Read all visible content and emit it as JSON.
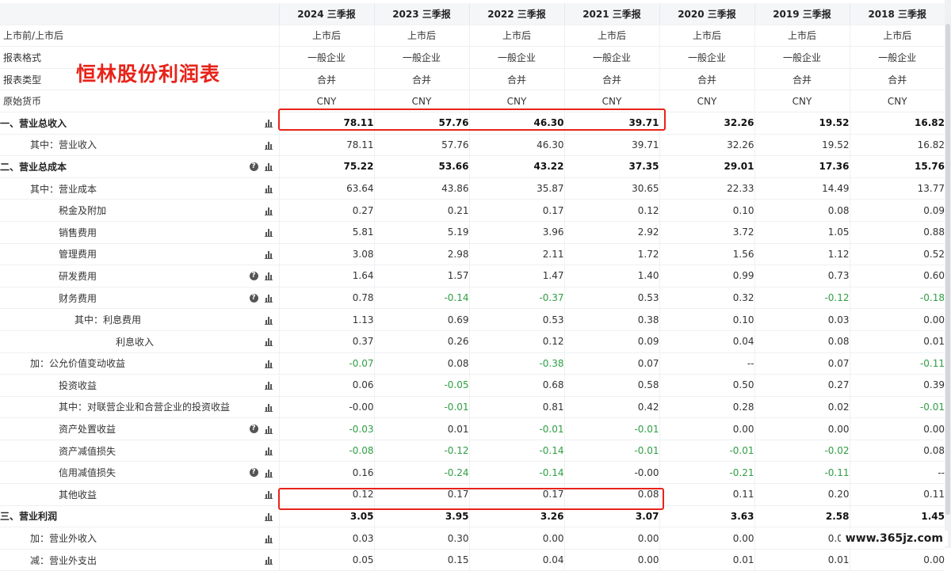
{
  "overlay_title": "恒林股份利润表",
  "watermark": "www.365jz.com",
  "columns": [
    "2024 三季报",
    "2023 三季报",
    "2022 三季报",
    "2021 三季报",
    "2020 三季报",
    "2019 三季报",
    "2018 三季报"
  ],
  "meta_rows": [
    {
      "label": "上市前/上市后",
      "values": [
        "上市后",
        "上市后",
        "上市后",
        "上市后",
        "上市后",
        "上市后",
        "上市后"
      ]
    },
    {
      "label": "报表格式",
      "values": [
        "一般企业",
        "一般企业",
        "一般企业",
        "一般企业",
        "一般企业",
        "一般企业",
        "一般企业"
      ]
    },
    {
      "label": "报表类型",
      "values": [
        "合并",
        "合并",
        "合并",
        "合并",
        "合并",
        "合并",
        "合并"
      ]
    },
    {
      "label": "原始货币",
      "values": [
        "CNY",
        "CNY",
        "CNY",
        "CNY",
        "CNY",
        "CNY",
        "CNY"
      ]
    }
  ],
  "rows": [
    {
      "label": "一、营业总收入",
      "indent": 0,
      "bold": true,
      "help": false,
      "values": [
        "78.11",
        "57.76",
        "46.30",
        "39.71",
        "32.26",
        "19.52",
        "16.82"
      ]
    },
    {
      "label": "其中：营业收入",
      "indent": 1,
      "bold": false,
      "help": false,
      "values": [
        "78.11",
        "57.76",
        "46.30",
        "39.71",
        "32.26",
        "19.52",
        "16.82"
      ]
    },
    {
      "label": "二、营业总成本",
      "indent": 0,
      "bold": true,
      "help": true,
      "values": [
        "75.22",
        "53.66",
        "43.22",
        "37.35",
        "29.01",
        "17.36",
        "15.76"
      ]
    },
    {
      "label": "其中：营业成本",
      "indent": 1,
      "bold": false,
      "help": false,
      "values": [
        "63.64",
        "43.86",
        "35.87",
        "30.65",
        "22.33",
        "14.49",
        "13.77"
      ]
    },
    {
      "label": "税金及附加",
      "indent": 2,
      "bold": false,
      "help": false,
      "values": [
        "0.27",
        "0.21",
        "0.17",
        "0.12",
        "0.10",
        "0.08",
        "0.09"
      ]
    },
    {
      "label": "销售费用",
      "indent": 2,
      "bold": false,
      "help": false,
      "values": [
        "5.81",
        "5.19",
        "3.96",
        "2.92",
        "3.72",
        "1.05",
        "0.88"
      ]
    },
    {
      "label": "管理费用",
      "indent": 2,
      "bold": false,
      "help": false,
      "values": [
        "3.08",
        "2.98",
        "2.11",
        "1.72",
        "1.56",
        "1.12",
        "0.52"
      ]
    },
    {
      "label": "研发费用",
      "indent": 2,
      "bold": false,
      "help": true,
      "values": [
        "1.64",
        "1.57",
        "1.47",
        "1.40",
        "0.99",
        "0.73",
        "0.60"
      ]
    },
    {
      "label": "财务费用",
      "indent": 2,
      "bold": false,
      "help": true,
      "values": [
        "0.78",
        "-0.14",
        "-0.37",
        "0.53",
        "0.32",
        "-0.12",
        "-0.18"
      ]
    },
    {
      "label": "其中：利息费用",
      "indent": 3,
      "bold": false,
      "help": false,
      "values": [
        "1.13",
        "0.69",
        "0.53",
        "0.38",
        "0.10",
        "0.03",
        "0.00"
      ]
    },
    {
      "label": "利息收入",
      "indent": 4,
      "bold": false,
      "help": false,
      "values": [
        "0.37",
        "0.26",
        "0.12",
        "0.09",
        "0.04",
        "0.08",
        "0.01"
      ]
    },
    {
      "label": "加：公允价值变动收益",
      "indent": 1,
      "bold": false,
      "help": false,
      "values": [
        "-0.07",
        "0.08",
        "-0.38",
        "0.07",
        "--",
        "0.07",
        "-0.11"
      ]
    },
    {
      "label": "投资收益",
      "indent": 2,
      "bold": false,
      "help": false,
      "values": [
        "0.06",
        "-0.05",
        "0.68",
        "0.58",
        "0.50",
        "0.27",
        "0.39"
      ]
    },
    {
      "label": "其中：对联营企业和合营企业的投资收益",
      "indent": 2,
      "bold": false,
      "help": false,
      "values": [
        "-0.00",
        "-0.01",
        "0.81",
        "0.42",
        "0.28",
        "0.02",
        "-0.01"
      ]
    },
    {
      "label": "资产处置收益",
      "indent": 2,
      "bold": false,
      "help": true,
      "values": [
        "-0.03",
        "0.01",
        "-0.01",
        "-0.01",
        "0.00",
        "0.00",
        "0.00"
      ]
    },
    {
      "label": "资产减值损失",
      "indent": 2,
      "bold": false,
      "help": false,
      "values": [
        "-0.08",
        "-0.12",
        "-0.14",
        "-0.01",
        "-0.01",
        "-0.02",
        "0.08"
      ]
    },
    {
      "label": "信用减值损失",
      "indent": 2,
      "bold": false,
      "help": true,
      "values": [
        "0.16",
        "-0.24",
        "-0.14",
        "-0.00",
        "-0.21",
        "-0.11",
        "--"
      ]
    },
    {
      "label": "其他收益",
      "indent": 2,
      "bold": false,
      "help": false,
      "values": [
        "0.12",
        "0.17",
        "0.17",
        "0.08",
        "0.11",
        "0.20",
        "0.11"
      ]
    },
    {
      "label": "三、营业利润",
      "indent": 0,
      "bold": true,
      "help": false,
      "values": [
        "3.05",
        "3.95",
        "3.26",
        "3.07",
        "3.63",
        "2.58",
        "1.45"
      ]
    },
    {
      "label": "加：营业外收入",
      "indent": 1,
      "bold": false,
      "help": false,
      "values": [
        "0.03",
        "0.30",
        "0.00",
        "0.00",
        "0.00",
        "0.09",
        "0.00"
      ]
    },
    {
      "label": "减：营业外支出",
      "indent": 1,
      "bold": false,
      "help": false,
      "values": [
        "0.05",
        "0.15",
        "0.04",
        "0.00",
        "0.01",
        "0.01",
        "0.00"
      ]
    }
  ],
  "colors": {
    "highlight": "#e8231a",
    "negative": "#2f9e44",
    "header_bg": "#f5f6f8"
  }
}
